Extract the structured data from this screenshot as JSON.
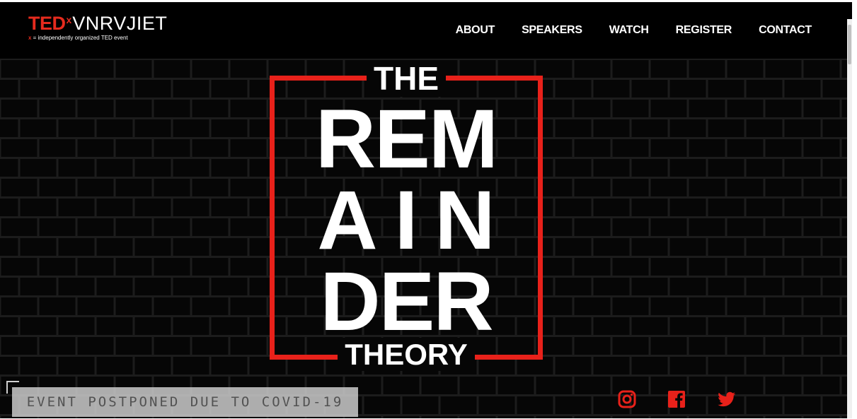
{
  "logo": {
    "ted": "TED",
    "x": "x",
    "event_name": "VNRVJIET",
    "tagline_x": "x",
    "tagline": " = independently organized TED event"
  },
  "nav": {
    "items": [
      {
        "label": "ABOUT"
      },
      {
        "label": "SPEAKERS"
      },
      {
        "label": "WATCH"
      },
      {
        "label": "REGISTER"
      },
      {
        "label": "CONTACT"
      }
    ]
  },
  "hero": {
    "top_word": "THE",
    "line1": "REM",
    "line2": "AIN",
    "line3": "DER",
    "bottom_word": "THEORY"
  },
  "banner": {
    "text": "EVENT POSTPONED DUE TO COVID-19"
  },
  "social": {
    "icons": [
      "instagram-icon",
      "facebook-icon",
      "twitter-icon"
    ]
  },
  "colors": {
    "accent": "#e62b1e",
    "frame": "#e8211a",
    "background": "#060606",
    "brick_line": "#1c1c1c"
  }
}
